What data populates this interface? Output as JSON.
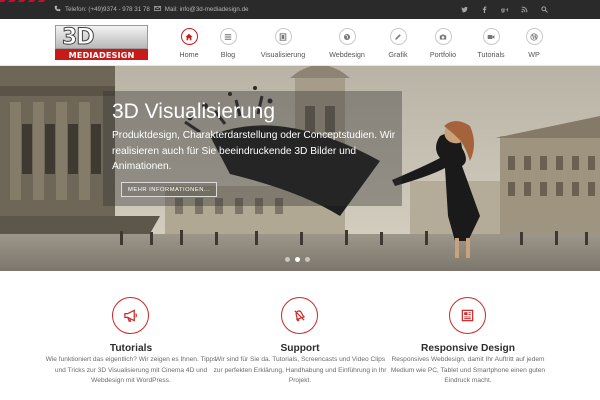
{
  "topbar": {
    "phone": "Telefon: (+49)9374 - 978 31 78",
    "mail": "Mail: info@3d-mediadesign.de",
    "social_icons": [
      "twitter-icon",
      "facebook-icon",
      "google-plus-icon",
      "rss-icon",
      "search-icon"
    ]
  },
  "header": {
    "logo_big": "3D",
    "logo_word": "MEDIADESIGN",
    "nav": [
      {
        "label": "Home",
        "icon": "home-icon",
        "active": true
      },
      {
        "label": "Blog",
        "icon": "list-icon"
      },
      {
        "label": "Visualisierung",
        "icon": "film-icon"
      },
      {
        "label": "Webdesign",
        "icon": "globe-icon"
      },
      {
        "label": "Grafik",
        "icon": "pencil-icon"
      },
      {
        "label": "Portfolio",
        "icon": "camera-icon"
      },
      {
        "label": "Tutorials",
        "icon": "video-icon"
      },
      {
        "label": "WP",
        "icon": "wordpress-icon"
      }
    ]
  },
  "hero": {
    "title": "3D Visualisierung",
    "text": "Produktdesign, Charakterdarstellung oder Conceptstudien. Wir realisieren auch für Sie beeindruckende 3D Bilder und Animationen.",
    "button": "MEHR INFORMATIONEN...",
    "slides": 3,
    "active_slide": 2
  },
  "features": [
    {
      "icon": "megaphone-icon",
      "title": "Tutorials",
      "text": "Wie funktioniert das eigentlich? Wir zeigen es Ihnen. Tipps und Tricks zur 3D Visualisierung mit Cinema 4D und Webdesign mit WordPress."
    },
    {
      "icon": "bell-icon",
      "title": "Support",
      "text": "Wir sind für Sie da. Tutorials, Screencasts und Video Clips zur perfekten Erklärung, Handhabung und Einführung in Ihr Projekt."
    },
    {
      "icon": "newspaper-icon",
      "title": "Responsive Design",
      "text": "Responsives Webdesign, damit Ihr Auftritt auf jedem Medium wie PC, Tablet und Smartphone einen guten Eindruck macht."
    }
  ],
  "colors": {
    "accent": "#c91a1a",
    "topbar": "#2a2a2a",
    "text": "#555555"
  }
}
